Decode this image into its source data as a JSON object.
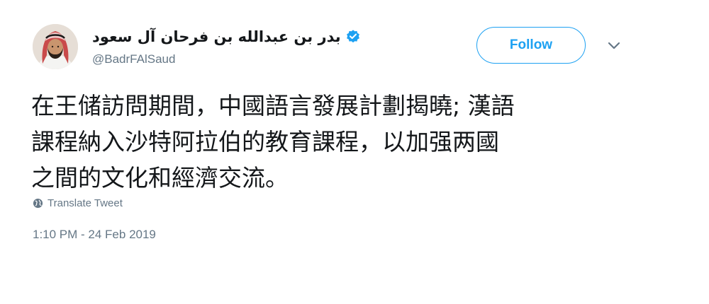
{
  "tweet": {
    "author": {
      "display_name": "بدر بن عبدالله بن فرحان آل سعود",
      "handle": "@BadrFAlSaud",
      "verified_icon": "verified-badge-icon",
      "avatar_icon": "avatar"
    },
    "follow_label": "Follow",
    "caret_icon": "chevron-down-icon",
    "text_lines": [
      "在王储訪問期間，中國語言發展計劃揭曉; 漢語",
      "課程納入沙特阿拉伯的教育課程，以加强两國",
      "之間的文化和經濟交流。"
    ],
    "translate": {
      "icon": "globe-icon",
      "label": "Translate Tweet"
    },
    "timestamp": "1:10 PM - 24 Feb 2019"
  },
  "colors": {
    "accent": "#1da1f2",
    "text": "#14171a",
    "muted": "#657786",
    "background": "#ffffff"
  }
}
